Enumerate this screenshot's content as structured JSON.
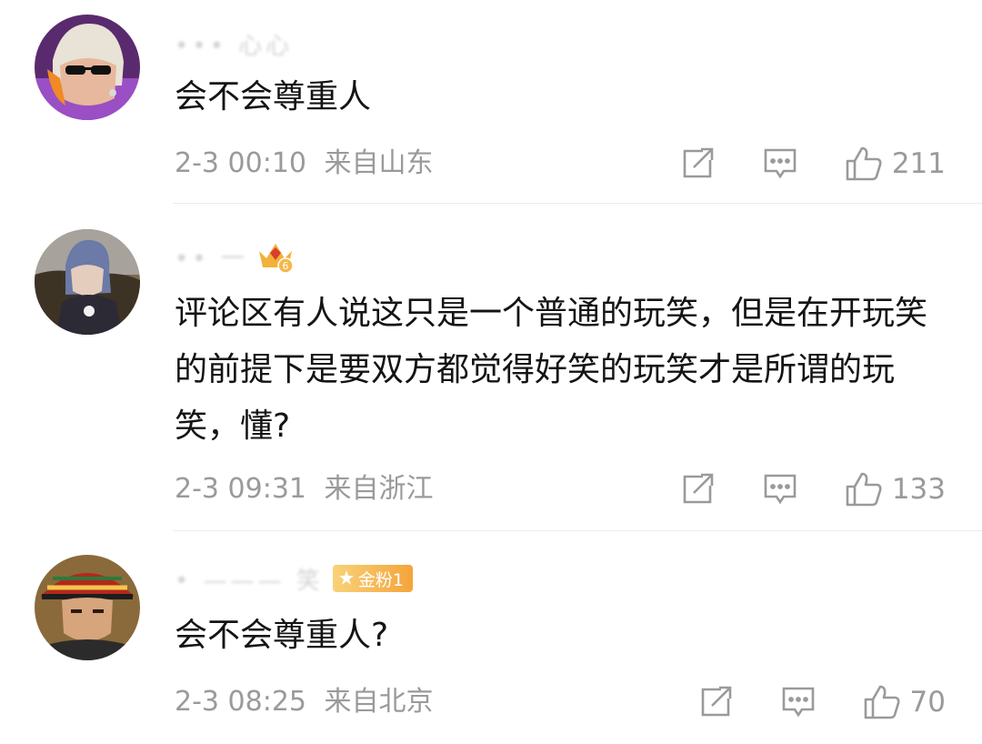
{
  "comments": [
    {
      "username": "••• 心心",
      "text": "会不会尊重人",
      "date": "2-3 00:10",
      "location": "来自山东",
      "likes": "211"
    },
    {
      "username": "•• 一",
      "level_badge": "6",
      "text": "评论区有人说这只是一个普通的玩笑，但是在开玩笑的前提下是要双方都觉得好笑的玩笑才是所谓的玩笑，懂?",
      "date": "2-3 09:31",
      "location": "来自浙江",
      "likes": "133"
    },
    {
      "username": "•  ——— 笑",
      "fan_badge": "金粉1",
      "text": "会不会尊重人?",
      "date": "2-3 08:25",
      "location": "来自北京",
      "likes": "70"
    }
  ],
  "icons": {
    "share": "share-icon",
    "reply": "comment-icon",
    "like": "thumbs-up-icon"
  },
  "colors": {
    "text": "#141414",
    "meta": "#9a9a9a",
    "fan_badge": "#f4a43a",
    "crown": "#f2b13a"
  }
}
